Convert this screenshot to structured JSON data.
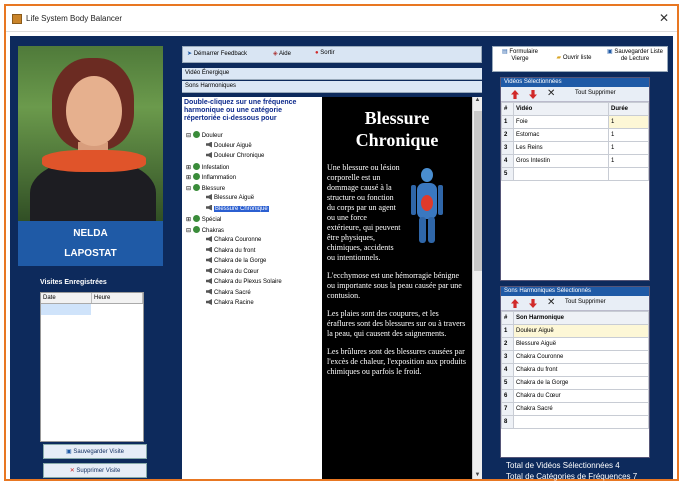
{
  "window": {
    "title": "Life System Body Balancer",
    "close_glyph": "✕"
  },
  "client": {
    "name_line1": "NELDA",
    "name_line2": "LAPOSTAT",
    "visits": {
      "label": "Visites Enregistrées",
      "columns": [
        "Date",
        "Heure"
      ],
      "save_label": "Sauvegarder Visite",
      "delete_label": "Supprimer Visite"
    }
  },
  "toolbar": {
    "feedback": "Démarrer Feedback",
    "help": "Aide",
    "exit": "Sortir"
  },
  "bands": {
    "videos": "Vidéo Énergique",
    "sounds": "Sons Harmoniques"
  },
  "instructions": "Double-cliquez sur une fréquence harmonique ou une catégorie répertoriée ci-dessous pour",
  "tree": [
    {
      "label": "Douleur",
      "kind": "cat",
      "sign": "⊟"
    },
    {
      "label": "Douleur Aiguë",
      "kind": "leaf"
    },
    {
      "label": "Douleur Chronique",
      "kind": "leaf"
    },
    {
      "label": "Infestation",
      "kind": "cat",
      "sign": "⊞"
    },
    {
      "label": "Inflammation",
      "kind": "cat",
      "sign": "⊞"
    },
    {
      "label": "Blessure",
      "kind": "cat",
      "sign": "⊟"
    },
    {
      "label": "Blessure Aiguë",
      "kind": "leaf"
    },
    {
      "label": "Blessure Chronique",
      "kind": "leaf",
      "selected": true
    },
    {
      "label": "Spécial",
      "kind": "cat",
      "sign": "⊞"
    },
    {
      "label": "Chakras",
      "kind": "cat",
      "sign": "⊟"
    },
    {
      "label": "Chakra Couronne",
      "kind": "leaf"
    },
    {
      "label": "Chakra du front",
      "kind": "leaf"
    },
    {
      "label": "Chakra de la Gorge",
      "kind": "leaf"
    },
    {
      "label": "Chakra du Cœur",
      "kind": "leaf"
    },
    {
      "label": "Chakra du Plexus Solaire",
      "kind": "leaf"
    },
    {
      "label": "Chakra Sacré",
      "kind": "leaf"
    },
    {
      "label": "Chakra Racine",
      "kind": "leaf"
    }
  ],
  "article": {
    "title_line1": "Blessure",
    "title_line2": "Chronique",
    "p1": "Une blessure ou lésion corporelle est un dommage causé à la structure ou fonction du corps par un agent ou une force extérieure, qui peuvent être physiques, chimiques, accidents ou intentionnels.",
    "p2": "L'ecchymose est une hémorragie bénigne ou importante sous la peau causée par une contusion.",
    "p3": "Les plaies sont des coupures, et les éraflures sont des blessures sur ou à travers la peau, qui causent des saignements.",
    "p4": "Les brûlures sont des blessures causées par l'excès de chaleur, l'exposition aux produits chimiques ou parfois le froid."
  },
  "right_toolbar": {
    "blank_form": "Formulaire Vierge",
    "open_list": "Ouvrir liste",
    "save_playlist": "Sauvegarder Liste de Lecture"
  },
  "videos_panel": {
    "caption": "Vidéos Sélectionnées",
    "delete_all": "Tout Supprimer",
    "columns": [
      "#",
      "Vidéo",
      "Durée"
    ],
    "rows": [
      [
        "1",
        "Foie",
        "1"
      ],
      [
        "2",
        "Estomac",
        "1"
      ],
      [
        "3",
        "Les Reins",
        "1"
      ],
      [
        "4",
        "Gros Intestin",
        "1"
      ],
      [
        "5",
        "",
        ""
      ]
    ]
  },
  "sounds_panel": {
    "caption": "Sons Harmoniques Sélectionnés",
    "delete_all": "Tout Supprimer",
    "columns": [
      "#",
      "Son Harmonique"
    ],
    "rows": [
      [
        "1",
        "Douleur Aiguë"
      ],
      [
        "2",
        "Blessure Aiguë"
      ],
      [
        "3",
        "Chakra Couronne"
      ],
      [
        "4",
        "Chakra du front"
      ],
      [
        "5",
        "Chakra de la Gorge"
      ],
      [
        "6",
        "Chakra du Cœur"
      ],
      [
        "7",
        "Chakra Sacré"
      ],
      [
        "8",
        ""
      ]
    ]
  },
  "totals": {
    "videos": "Total de Vidéos Sélectionnées 4",
    "sounds": "Total de Catégories de Fréquences 7"
  },
  "colors": {
    "frame": "#e87722",
    "client_bg": "#0d2a5c",
    "accent": "#1f5aa6",
    "selection": "#2b5fd1"
  }
}
